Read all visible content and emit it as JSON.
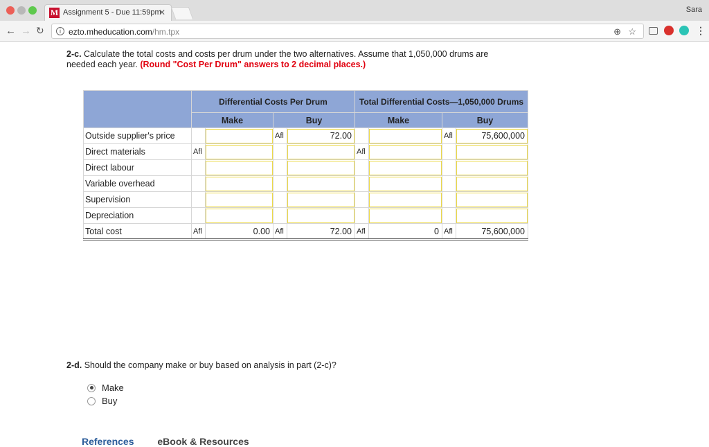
{
  "browser": {
    "tab_title": "Assignment 5 - Due 11:59pm",
    "tab_favicon": "M",
    "profile_name": "Sara",
    "url_domain": "ezto.mheducation.com",
    "url_path": "/hm.tpx",
    "icons": [
      "back-icon",
      "forward-icon",
      "reload-icon",
      "info-icon",
      "zoom-icon",
      "star-icon",
      "cast-icon",
      "extension-icon",
      "menu-icon"
    ]
  },
  "question_c": {
    "number": "2-c.",
    "text": "Calculate the total costs and costs per drum under the two alternatives. Assume that 1,050,000 drums are needed each year.",
    "instruction": "(Round \"Cost Per Drum\" answers to 2 decimal places.)"
  },
  "table": {
    "group_per_drum": "Differential Costs Per Drum",
    "group_total": "Total Differential Costs—1,050,000 Drums",
    "col_make": "Make",
    "col_buy": "Buy",
    "currency": "Afl",
    "rows": [
      {
        "label": "Outside supplier's price",
        "pd_make": "",
        "pd_buy": "72.00",
        "t_make": "",
        "t_buy": "75,600,000"
      },
      {
        "label": "Direct materials",
        "pd_make": "",
        "pd_buy": "",
        "t_make": "",
        "t_buy": ""
      },
      {
        "label": "Direct labour",
        "pd_make": "",
        "pd_buy": "",
        "t_make": "",
        "t_buy": ""
      },
      {
        "label": "Variable overhead",
        "pd_make": "",
        "pd_buy": "",
        "t_make": "",
        "t_buy": ""
      },
      {
        "label": "Supervision",
        "pd_make": "",
        "pd_buy": "",
        "t_make": "",
        "t_buy": ""
      },
      {
        "label": "Depreciation",
        "pd_make": "",
        "pd_buy": "",
        "t_make": "",
        "t_buy": ""
      }
    ],
    "total": {
      "label": "Total cost",
      "pd_make": "0.00",
      "pd_buy": "72.00",
      "t_make": "0",
      "t_buy": "75,600,000"
    }
  },
  "question_d": {
    "number": "2-d.",
    "text": "Should the company make or buy based on analysis in part (2-c)?",
    "options": [
      {
        "label": "Make",
        "selected": true
      },
      {
        "label": "Buy",
        "selected": false
      }
    ]
  },
  "bottom_tabs": [
    "References",
    "eBook & Resources"
  ]
}
